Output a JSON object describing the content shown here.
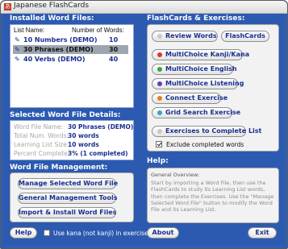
{
  "window": {
    "title": "Japanese FlashCards"
  },
  "installed": {
    "title": "Installed Word Files:",
    "col_name": "List Name:",
    "col_count": "Number of Words:",
    "items": [
      {
        "name": "10 Numbers (DEMO)",
        "count": "10",
        "selected": false
      },
      {
        "name": "30 Phrases (DEMO)",
        "count": "30",
        "selected": true
      },
      {
        "name": "40 Verbs (DEMO)",
        "count": "40",
        "selected": false
      }
    ]
  },
  "details": {
    "title": "Selected Word File Details:",
    "rows": [
      {
        "label": "Word File Name:",
        "value": "30 Phrases (DEMO)"
      },
      {
        "label": "Total Num. Words:",
        "value": "30 words"
      },
      {
        "label": "Learning List Size:",
        "value": "10 words"
      },
      {
        "label": "Percent Complete:",
        "value": "3% (1 completed)"
      }
    ]
  },
  "management": {
    "title": "Word File Management:",
    "buttons": [
      "Manage Selected Word File",
      "General Management Tools",
      "Import & Install Word Files"
    ]
  },
  "bottom": {
    "help_label": "Help",
    "kana_label": "Use kana (not kanji) in exercises",
    "kana_checked": false,
    "about_label": "About",
    "exit_label": "Exit"
  },
  "exercises": {
    "title": "FlashCards & Exercises:",
    "review_label": "Review Words",
    "flashcards_label": "FlashCards",
    "items": [
      {
        "label": "MultiChoice Kanji/Kana",
        "color": "#d63a2b"
      },
      {
        "label": "MultiChoice English",
        "color": "#2fa83c"
      },
      {
        "label": "MultiChoice Listening",
        "color": "#5b3fbf"
      },
      {
        "label": "Connect Exercise",
        "color": "#e6821f"
      },
      {
        "label": "Grid Search Exercise",
        "color": "#3aa6b8"
      }
    ],
    "complete_label": "Exercises to Complete List",
    "exclude_label": "Exclude completed words",
    "exclude_checked": true
  },
  "help": {
    "title": "Help:",
    "heading": "General Overview:",
    "body": "Start by importing a Word File, then use the FlashCards to study its Learning List words, then complete the Exercises. Use the \"Manage Selected Word File\" button to modify the Word File and its Learning List."
  }
}
